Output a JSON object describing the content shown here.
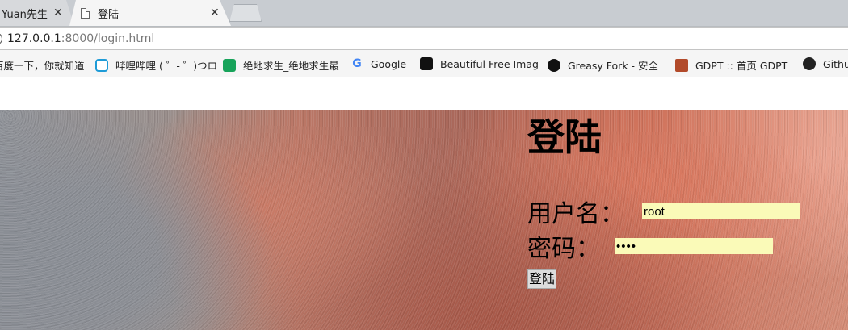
{
  "tabs": [
    {
      "title": "Yuan先生",
      "active": false,
      "close": "✕"
    },
    {
      "title": "登陆",
      "active": true,
      "close": "✕"
    }
  ],
  "address": {
    "host": "127.0.0.1",
    "rest": ":8000/login.html"
  },
  "bookmarks": [
    {
      "label": "百度一下，你就知道",
      "icon": "baidu-icon"
    },
    {
      "label": "哔哩哔哩 ( ゜- ゜)つロ",
      "icon": "bilibili-icon"
    },
    {
      "label": "绝地求生_绝地求生最",
      "icon": "pubg-icon"
    },
    {
      "label": "Google",
      "icon": "google-icon"
    },
    {
      "label": "Beautiful Free Imag",
      "icon": "camera-icon"
    },
    {
      "label": "Greasy Fork - 安全",
      "icon": "greasy-fork-icon"
    },
    {
      "label": "GDPT :: 首页 GDPT",
      "icon": "gdpt-icon"
    },
    {
      "label": "Githu",
      "icon": "github-icon"
    }
  ],
  "login": {
    "title": "登陆",
    "username_label": "用户名：",
    "username_value": "root",
    "password_label": "密码：",
    "password_value": "••••",
    "submit_label": "登陆"
  },
  "colors": {
    "input_autofill": "#fafab8",
    "hero_warm": "#c56e59",
    "hero_cool": "#8f9298"
  }
}
